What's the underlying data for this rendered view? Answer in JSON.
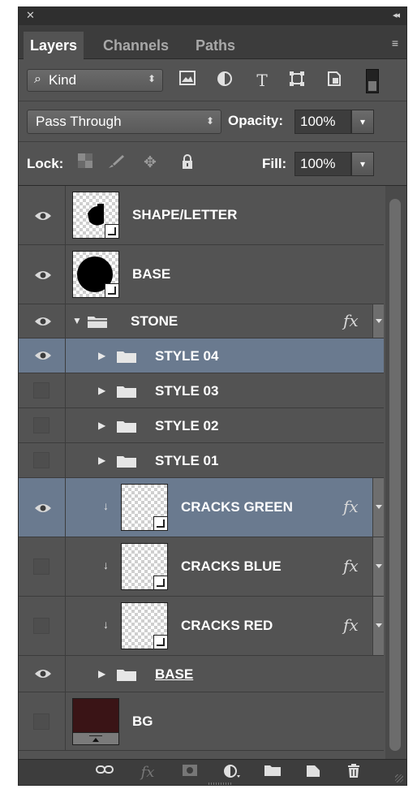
{
  "titlebar": {
    "close": "✕",
    "collapse": "◂◂"
  },
  "tabs": [
    {
      "label": "Layers",
      "active": true
    },
    {
      "label": "Channels",
      "active": false
    },
    {
      "label": "Paths",
      "active": false
    }
  ],
  "panel_menu_icon": "≡",
  "filter": {
    "kind_label": "Kind",
    "icons": [
      "image-filter-icon",
      "adjustment-filter-icon",
      "type-filter-icon",
      "shape-filter-icon",
      "smart-object-filter-icon",
      "filter-toggle-icon"
    ]
  },
  "blend": {
    "mode": "Pass Through",
    "opacity_label": "Opacity:",
    "opacity_value": "100%"
  },
  "lock": {
    "label": "Lock:",
    "fill_label": "Fill:",
    "fill_value": "100%"
  },
  "layers": [
    {
      "name": "SHAPE/LETTER",
      "kind": "smart",
      "visible": true,
      "selected": false,
      "indent": 0
    },
    {
      "name": "BASE",
      "kind": "smart",
      "visible": true,
      "selected": false,
      "indent": 0
    },
    {
      "name": "STONE",
      "kind": "group-open",
      "visible": true,
      "selected": false,
      "indent": 0,
      "fx": true
    },
    {
      "name": "STYLE 04",
      "kind": "group",
      "visible": true,
      "selected": true,
      "indent": 1
    },
    {
      "name": "STYLE 03",
      "kind": "group",
      "visible": false,
      "selected": false,
      "indent": 1
    },
    {
      "name": "STYLE 02",
      "kind": "group",
      "visible": false,
      "selected": false,
      "indent": 1
    },
    {
      "name": "STYLE 01",
      "kind": "group",
      "visible": false,
      "selected": false,
      "indent": 1
    },
    {
      "name": "CRACKS GREEN",
      "kind": "smart-clip",
      "visible": true,
      "selected": true,
      "indent": 1,
      "fx": true
    },
    {
      "name": "CRACKS BLUE",
      "kind": "smart-clip",
      "visible": false,
      "selected": false,
      "indent": 1,
      "fx": true
    },
    {
      "name": "CRACKS RED",
      "kind": "smart-clip",
      "visible": false,
      "selected": false,
      "indent": 1,
      "fx": true
    },
    {
      "name": "BASE",
      "kind": "group",
      "visible": true,
      "selected": false,
      "indent": 0,
      "underline": true
    },
    {
      "name": "BG",
      "kind": "fill",
      "visible": false,
      "selected": false,
      "indent": 0
    }
  ],
  "fx_label": "fx",
  "bottom_icons": [
    "link-layers-icon",
    "layer-style-icon",
    "add-mask-icon",
    "new-adjustment-icon",
    "new-group-icon",
    "new-layer-icon",
    "delete-layer-icon"
  ],
  "colors": {
    "panel": "#535353",
    "selected": "#6a7a8f",
    "bg_fill": "#3a1416"
  }
}
